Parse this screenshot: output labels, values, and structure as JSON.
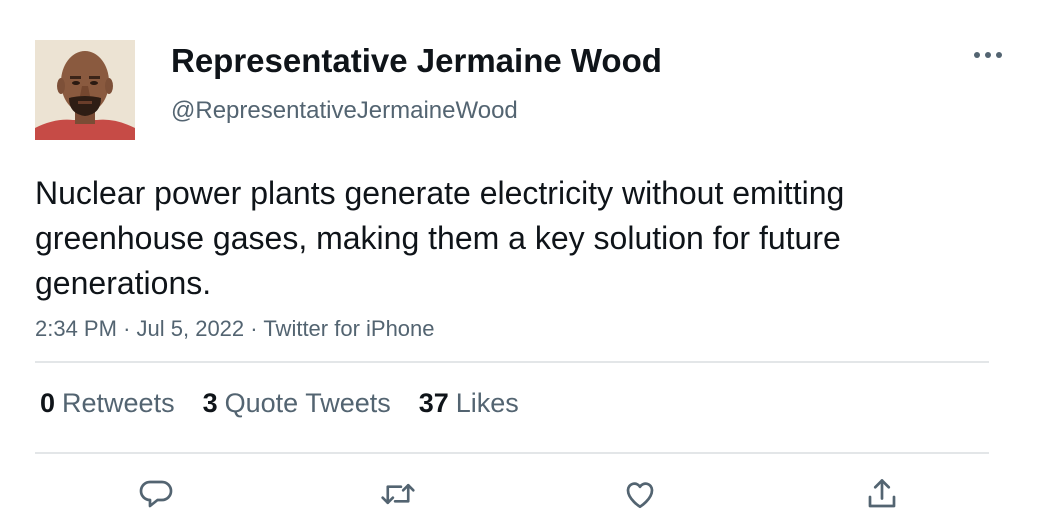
{
  "author": {
    "display_name": "Representative Jermaine Wood",
    "handle": "@RepresentativeJermaineWood",
    "avatar_icon": "profile-photo"
  },
  "tweet": {
    "text": "Nuclear power plants generate electricity without emitting greenhouse gases, making them a key solution for future generations.",
    "time": "2:34 PM",
    "date": "Jul 5, 2022",
    "source": "Twitter for iPhone",
    "separator": "·"
  },
  "stats": {
    "retweets": {
      "count": "0",
      "label": "Retweets"
    },
    "quote_tweets": {
      "count": "3",
      "label": "Quote Tweets"
    },
    "likes": {
      "count": "37",
      "label": "Likes"
    }
  },
  "actions": {
    "reply_icon": "reply-icon",
    "retweet_icon": "retweet-icon",
    "like_icon": "heart-icon",
    "share_icon": "share-icon",
    "more_icon": "more-icon"
  },
  "colors": {
    "text_primary": "#0f1419",
    "text_secondary": "#536471",
    "divider": "#e3e6e8"
  }
}
